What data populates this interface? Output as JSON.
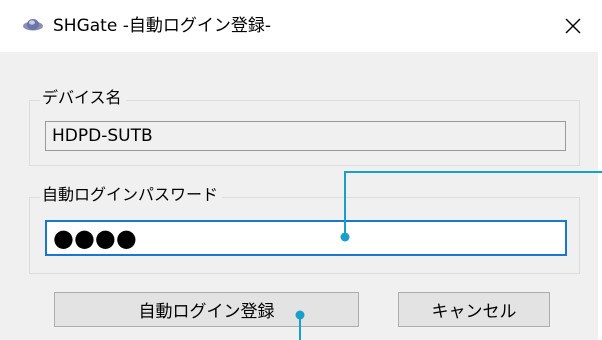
{
  "window": {
    "title": "SHGate -自動ログイン登録-",
    "close_glyph": "✕"
  },
  "device_group": {
    "legend": "デバイス名",
    "value": "HDPD-SUTB"
  },
  "password_group": {
    "legend": "自動ログインパスワード",
    "value": "●●●●"
  },
  "buttons": {
    "register_label": "自動ログイン登録",
    "cancel_label": "キャンセル"
  },
  "colors": {
    "dialog_bg": "#f0f0f0",
    "focus_border": "#1a77d0",
    "callout": "#1aa0c8"
  }
}
